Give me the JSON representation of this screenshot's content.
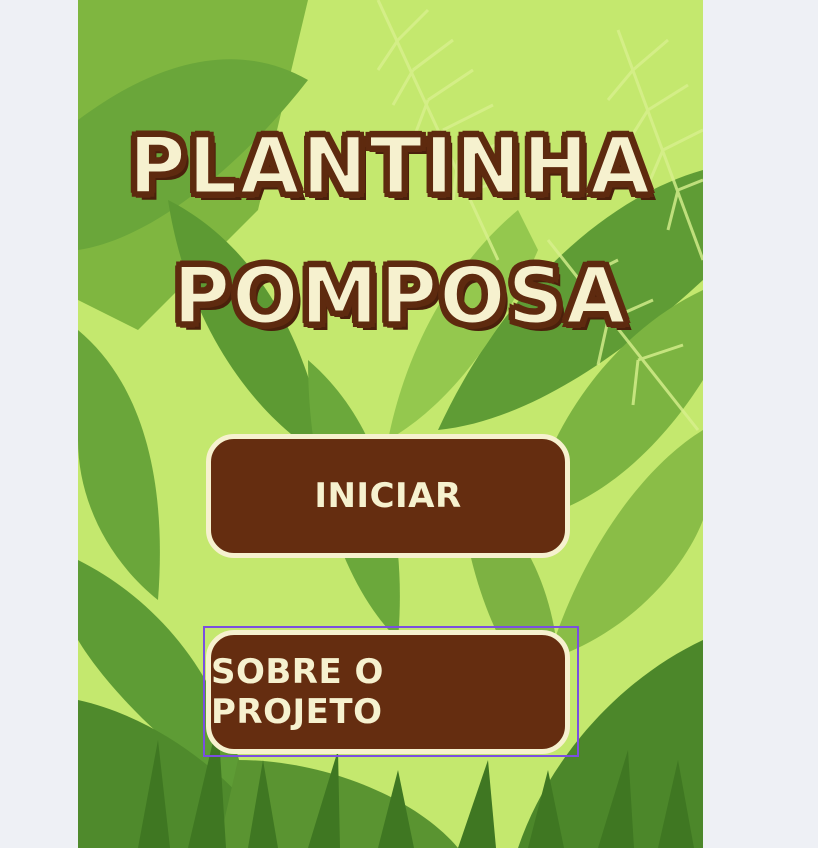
{
  "game": {
    "title_line1": "PLANTINHA",
    "title_line2": "POMPOSA"
  },
  "menu": {
    "start_label": "INICIAR",
    "about_label": "SOBRE O PROJETO"
  },
  "colors": {
    "button_bg": "#652d10",
    "button_text": "#f6f1cf",
    "title_outline": "#5e2a0f",
    "focus_ring": "#7a4fe0"
  }
}
